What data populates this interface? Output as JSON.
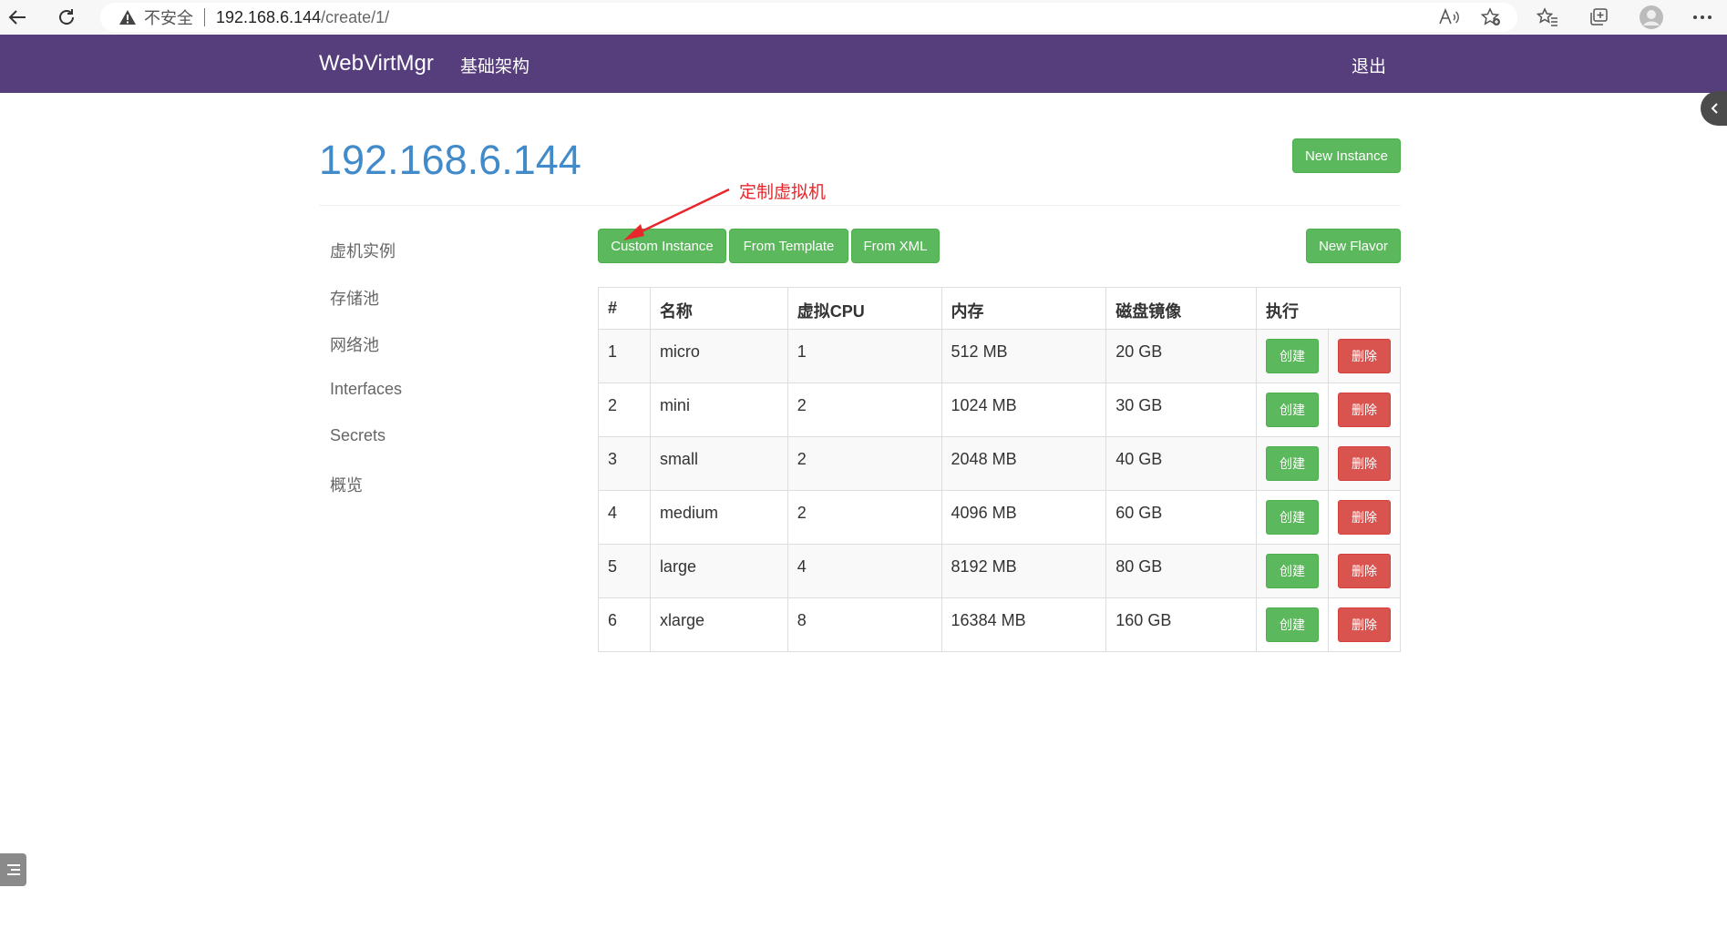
{
  "browser": {
    "insecure_label": "不安全",
    "url_host": "192.168.6.144",
    "url_path": "/create/1/"
  },
  "navbar": {
    "brand": "WebVirtMgr",
    "infrastructure": "基础架构",
    "logout": "退出",
    "bg_color": "#563d7c"
  },
  "page": {
    "title": "192.168.6.144",
    "new_instance": "New Instance",
    "annotation": "定制虚拟机"
  },
  "sidebar": {
    "items": [
      {
        "label": "虚机实例"
      },
      {
        "label": "存储池"
      },
      {
        "label": "网络池"
      },
      {
        "label": "Interfaces"
      },
      {
        "label": "Secrets"
      },
      {
        "label": "概览"
      }
    ]
  },
  "toolbar": {
    "custom_instance": "Custom Instance",
    "from_template": "From Template",
    "from_xml": "From XML",
    "new_flavor": "New Flavor"
  },
  "table": {
    "headers": [
      "#",
      "名称",
      "虚拟CPU",
      "内存",
      "磁盘镜像",
      "执行"
    ],
    "create_label": "创建",
    "delete_label": "删除",
    "rows": [
      {
        "id": "1",
        "name": "micro",
        "vcpu": "1",
        "memory": "512 MB",
        "disk": "20 GB"
      },
      {
        "id": "2",
        "name": "mini",
        "vcpu": "2",
        "memory": "1024 MB",
        "disk": "30 GB"
      },
      {
        "id": "3",
        "name": "small",
        "vcpu": "2",
        "memory": "2048 MB",
        "disk": "40 GB"
      },
      {
        "id": "4",
        "name": "medium",
        "vcpu": "2",
        "memory": "4096 MB",
        "disk": "60 GB"
      },
      {
        "id": "5",
        "name": "large",
        "vcpu": "4",
        "memory": "8192 MB",
        "disk": "80 GB"
      },
      {
        "id": "6",
        "name": "xlarge",
        "vcpu": "8",
        "memory": "16384 MB",
        "disk": "160 GB"
      }
    ]
  },
  "colors": {
    "success": "#5cb85c",
    "danger": "#d9534f",
    "title": "#428bca",
    "annotation": "#e8262c"
  }
}
